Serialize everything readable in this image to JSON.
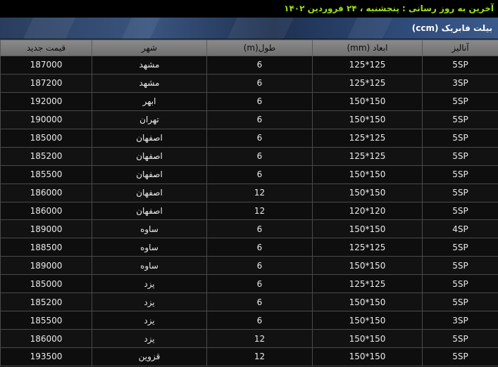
{
  "header": {
    "update_text": "آخرین به روز رسانی : پنجشنبه ، ۲۴ فروردین ۱۴۰۲"
  },
  "banner": {
    "title": "بیلت فابریک (ccm)"
  },
  "table": {
    "headers": {
      "analysis": "آنالیز",
      "dimensions": "ابعاد (mm)",
      "length": "طول(m)",
      "city": "شهر",
      "price": "قیمت جدید"
    },
    "rows": [
      {
        "analysis": "5SP",
        "dimensions": "125*125",
        "length": "6",
        "city": "مشهد",
        "price": "187000"
      },
      {
        "analysis": "3SP",
        "dimensions": "125*125",
        "length": "6",
        "city": "مشهد",
        "price": "187200"
      },
      {
        "analysis": "5SP",
        "dimensions": "150*150",
        "length": "6",
        "city": "ابهر",
        "price": "192000"
      },
      {
        "analysis": "5SP",
        "dimensions": "150*150",
        "length": "6",
        "city": "تهران",
        "price": "190000"
      },
      {
        "analysis": "5SP",
        "dimensions": "125*125",
        "length": "6",
        "city": "اصفهان",
        "price": "185000"
      },
      {
        "analysis": "5SP",
        "dimensions": "125*125",
        "length": "6",
        "city": "اصفهان",
        "price": "185200"
      },
      {
        "analysis": "5SP",
        "dimensions": "150*150",
        "length": "6",
        "city": "اصفهان",
        "price": "185500"
      },
      {
        "analysis": "5SP",
        "dimensions": "150*150",
        "length": "12",
        "city": "اصفهان",
        "price": "186000"
      },
      {
        "analysis": "5SP",
        "dimensions": "120*120",
        "length": "12",
        "city": "اصفهان",
        "price": "186000"
      },
      {
        "analysis": "4SP",
        "dimensions": "150*150",
        "length": "6",
        "city": "ساوه",
        "price": "189000"
      },
      {
        "analysis": "5SP",
        "dimensions": "125*125",
        "length": "6",
        "city": "ساوه",
        "price": "188500"
      },
      {
        "analysis": "5SP",
        "dimensions": "150*150",
        "length": "6",
        "city": "ساوه",
        "price": "189000"
      },
      {
        "analysis": "5SP",
        "dimensions": "125*125",
        "length": "6",
        "city": "یزد",
        "price": "185000"
      },
      {
        "analysis": "5SP",
        "dimensions": "150*150",
        "length": "6",
        "city": "یزد",
        "price": "185200"
      },
      {
        "analysis": "3SP",
        "dimensions": "150*150",
        "length": "6",
        "city": "یزد",
        "price": "185500"
      },
      {
        "analysis": "5SP",
        "dimensions": "150*150",
        "length": "12",
        "city": "یزد",
        "price": "186000"
      },
      {
        "analysis": "5SP",
        "dimensions": "150*150",
        "length": "12",
        "city": "قزوین",
        "price": "193500"
      }
    ]
  }
}
